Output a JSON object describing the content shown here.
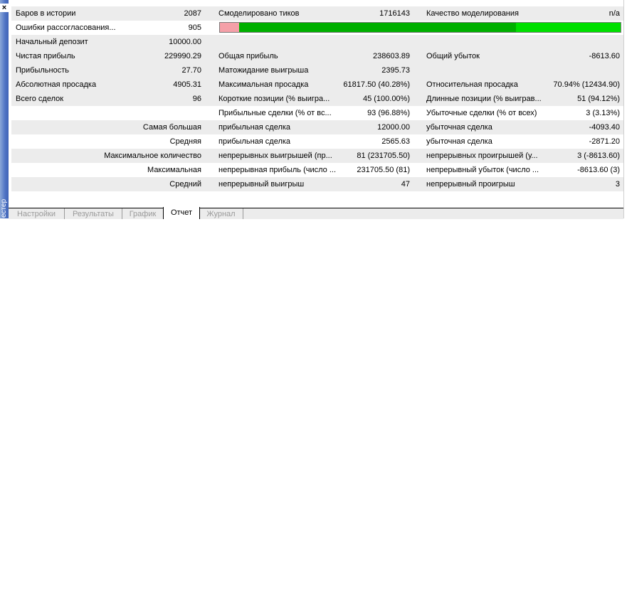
{
  "window": {
    "close_glyph": "×",
    "side_label": "естер"
  },
  "rows": [
    {
      "c0": "Баров в истории",
      "c1": "2087",
      "c2": "Смоделировано тиков",
      "c3": "1716143",
      "c4": "Качество моделирования",
      "c5": "n/a"
    },
    {
      "c0": "Ошибки рассогласования...",
      "c1": "905"
    },
    {
      "c0": "Начальный депозит",
      "c1": "10000.00"
    },
    {
      "c0": "Чистая прибыль",
      "c1": "229990.29",
      "c2": "Общая прибыль",
      "c3": "238603.89",
      "c4": "Общий убыток",
      "c5": "-8613.60"
    },
    {
      "c0": "Прибыльность",
      "c1": "27.70",
      "c2": "Матожидание выигрыша",
      "c3": "2395.73"
    },
    {
      "c0": "Абсолютная просадка",
      "c1": "4905.31",
      "c2": "Максимальная просадка",
      "c3": "61817.50 (40.28%)",
      "c4": "Относительная просадка",
      "c5": "70.94% (12434.90)"
    },
    {
      "c0": "Всего сделок",
      "c1": "96",
      "c2": "Короткие позиции (% выигра...",
      "c3": "45 (100.00%)",
      "c4": "Длинные позиции (% выиграв...",
      "c5": "51 (94.12%)"
    },
    {
      "c2": "Прибыльные сделки (% от вс...",
      "c3": "93 (96.88%)",
      "c4": "Убыточные сделки (% от всех)",
      "c5": "3 (3.13%)"
    },
    {
      "c01": "Самая большая",
      "c2": "прибыльная сделка",
      "c3": "12000.00",
      "c4": "убыточная сделка",
      "c5": "-4093.40"
    },
    {
      "c01": "Средняя",
      "c2": "прибыльная сделка",
      "c3": "2565.63",
      "c4": "убыточная сделка",
      "c5": "-2871.20"
    },
    {
      "c01": "Максимальное количество",
      "c2": "непрерывных выигрышей (пр...",
      "c3": "81 (231705.50)",
      "c4": "непрерывных проигрышей (у...",
      "c5": "3 (-8613.60)"
    },
    {
      "c01": "Максимальная",
      "c2": "непрерывная прибыль (число ...",
      "c3": "231705.50 (81)",
      "c4": "непрерывный убыток (число ...",
      "c5": "-8613.60 (3)"
    },
    {
      "c01": "Средний",
      "c2": "непрерывный выигрыш",
      "c3": "47",
      "c4": "непрерывный проигрыш",
      "c5": "3"
    }
  ],
  "quality_bar": {
    "segments": [
      "pink",
      "green",
      "lime"
    ],
    "colors": {
      "pink": "#f5a0a8",
      "green": "#00b000",
      "lime": "#00e000"
    }
  },
  "tabs": [
    {
      "label": "Настройки",
      "active": false
    },
    {
      "label": "Результаты",
      "active": false
    },
    {
      "label": "График",
      "active": false
    },
    {
      "label": "Отчет",
      "active": true
    },
    {
      "label": "Журнал",
      "active": false
    }
  ]
}
